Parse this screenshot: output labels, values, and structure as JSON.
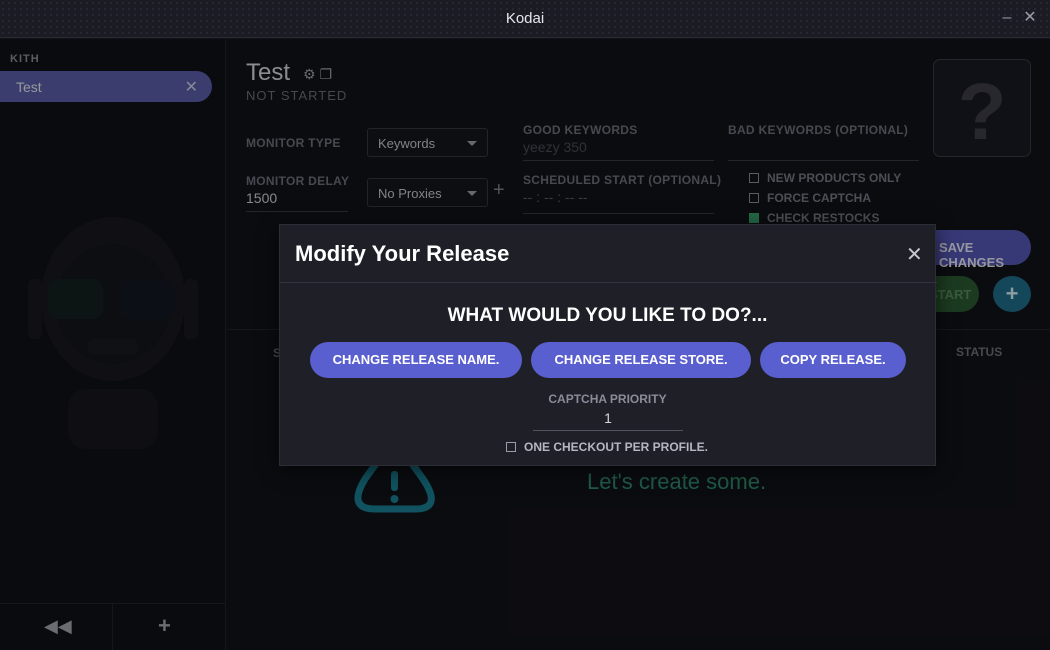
{
  "window": {
    "title": "Kodai"
  },
  "sidebar": {
    "store_heading": "KITH",
    "items": [
      {
        "label": "Test"
      }
    ]
  },
  "task": {
    "name": "Test",
    "status": "NOT STARTED",
    "monitor_type_label": "MONITOR TYPE",
    "monitor_type_value": "Keywords",
    "monitor_delay_label": "MONITOR DELAY",
    "monitor_delay_value": "1500",
    "proxy_value": "No Proxies",
    "good_keywords_label": "GOOD KEYWORDS",
    "good_keywords_placeholder": "yeezy 350",
    "bad_keywords_label": "BAD KEYWORDS (OPTIONAL)",
    "scheduled_start_label": "SCHEDULED START (OPTIONAL)",
    "scheduled_start_placeholder": "-- : -- : --   --",
    "checkboxes": [
      {
        "label": "NEW PRODUCTS ONLY",
        "checked": false
      },
      {
        "label": "FORCE CAPTCHA",
        "checked": false
      },
      {
        "label": "CHECK RESTOCKS",
        "checked": true
      }
    ],
    "save_label": "SAVE CHANGES",
    "start_label": "START",
    "add_label": "+"
  },
  "table": {
    "headers": {
      "left": "S",
      "right": "STATUS"
    },
    "empty_text": "Let's create some."
  },
  "modal": {
    "title": "Modify Your Release",
    "question": "WHAT WOULD YOU LIKE TO DO?...",
    "buttons": [
      "CHANGE RELEASE NAME.",
      "CHANGE RELEASE STORE.",
      "COPY RELEASE."
    ],
    "captcha_priority_label": "CAPTCHA PRIORITY",
    "captcha_priority_value": "1",
    "one_checkout_label": "ONE CHECKOUT PER PROFILE."
  },
  "colors": {
    "accent": "#5a5fcf",
    "success": "#3aa06a",
    "info": "#1f6d8a"
  }
}
